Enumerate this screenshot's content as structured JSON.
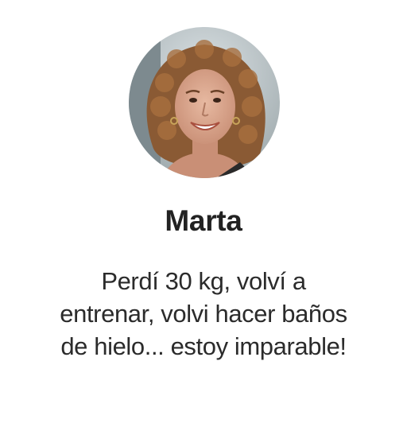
{
  "testimonial": {
    "name": "Marta",
    "quote_lines": [
      "Perdí 30 kg, volví a",
      "entrenar, volvi hacer baños",
      "de hielo... estoy imparable!"
    ]
  },
  "icons": {
    "avatar": "user-photo"
  },
  "colors": {
    "background": "#ffffff",
    "name_text": "#222222",
    "quote_text": "#2b2b2b"
  }
}
